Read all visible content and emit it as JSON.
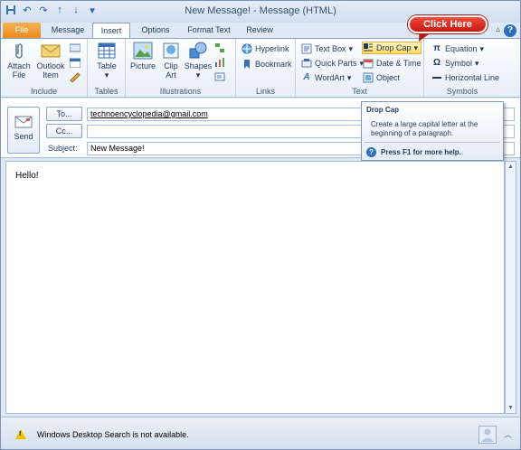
{
  "window": {
    "title": "New Message! - Message (HTML)"
  },
  "qat": {
    "save": "💾",
    "undo": "↶",
    "redo": "↷",
    "up": "↑",
    "down": "↓",
    "customize": "▾"
  },
  "tabs": [
    "File",
    "Message",
    "Insert",
    "Options",
    "Format Text",
    "Review"
  ],
  "active_tab": "Insert",
  "ribbon": {
    "include": {
      "label": "Include",
      "attach_file": "Attach\nFile",
      "attach_file_l1": "Attach",
      "attach_file_l2": "File",
      "outlook_item_l1": "Outlook",
      "outlook_item_l2": "Item"
    },
    "tables": {
      "label": "Tables",
      "table": "Table"
    },
    "illustrations": {
      "label": "Illustrations",
      "picture": "Picture",
      "clip_art_l1": "Clip",
      "clip_art_l2": "Art",
      "shapes": "Shapes"
    },
    "links": {
      "label": "Links",
      "hyperlink": "Hyperlink",
      "bookmark": "Bookmark"
    },
    "text": {
      "label": "Text",
      "text_box": "Text Box",
      "quick_parts": "Quick Parts",
      "wordart": "WordArt",
      "drop_cap": "Drop Cap",
      "date_time": "Date & Time",
      "object": "Object"
    },
    "symbols": {
      "label": "Symbols",
      "equation": "Equation",
      "symbol": "Symbol",
      "horizontal_line": "Horizontal Line"
    }
  },
  "callout": {
    "text": "Click Here"
  },
  "tooltip": {
    "title": "Drop Cap",
    "description": "Create a large capital letter at the beginning of a paragraph.",
    "help": "Press F1 for more help."
  },
  "header": {
    "send": "Send",
    "to_button": "To...",
    "cc_button": "Cc...",
    "subject_label": "Subject:",
    "to_value": "technoencyclopedia@gmail.com",
    "cc_value": "",
    "subject_value": "New Message!"
  },
  "body": {
    "text": "Hello!"
  },
  "status": {
    "message": "Windows Desktop Search is not available."
  }
}
